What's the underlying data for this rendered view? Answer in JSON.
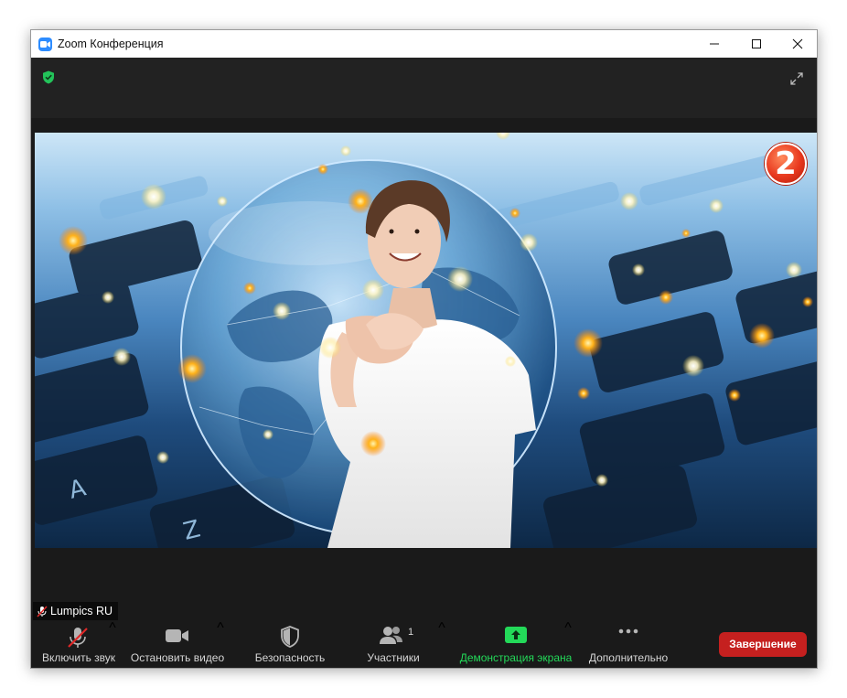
{
  "window": {
    "title": "Zoom Конференция",
    "controls": {
      "minimize": "minimize",
      "maximize": "maximize",
      "close": "close"
    }
  },
  "meeting": {
    "badge_number": "2",
    "participant_name": "Lumpics RU",
    "participant_muted": true
  },
  "toolbar": {
    "unmute_label": "Включить звук",
    "stop_video_label": "Остановить видео",
    "security_label": "Безопасность",
    "participants_label": "Участники",
    "participants_count": "1",
    "share_screen_label": "Демонстрация экрана",
    "more_label": "Дополнительно",
    "end_label": "Завершение"
  },
  "colors": {
    "end_button": "#c5201f",
    "share_green": "#23d959",
    "zoom_blue": "#2d8cff",
    "toolbar_bg": "#1a1a1a"
  },
  "icons": [
    "zoom-app-icon",
    "shield-check-icon",
    "fullscreen-icon",
    "mic-muted-icon",
    "video-camera-icon",
    "security-shield-icon",
    "participants-icon",
    "share-screen-icon",
    "more-dots-icon"
  ]
}
